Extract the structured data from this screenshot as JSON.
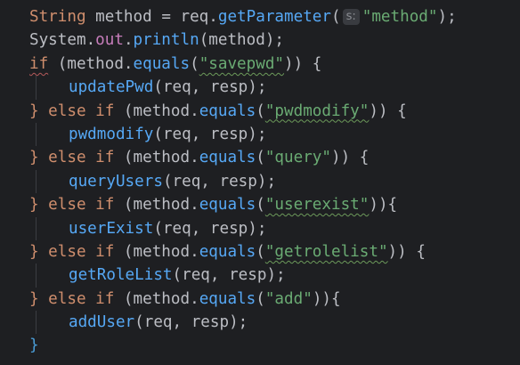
{
  "code": {
    "line1": {
      "type": "String",
      "var": "method",
      "eq": "=",
      "obj": "req",
      "call": "getParameter",
      "hint": "s:",
      "arg": "\"method\"",
      "tail": ");"
    },
    "line2": {
      "obj": "System",
      "field": "out",
      "call": "println",
      "args": "(method);"
    },
    "branches": [
      {
        "prefix": "if",
        "cond_open": " (method.",
        "equals": "equals",
        "arg": "\"savepwd\"",
        "cond_close": ")) {",
        "handler": "updatePwd",
        "handler_args": "(req, resp);"
      },
      {
        "prefix": "} else if",
        "cond_open": " (method.",
        "equals": "equals",
        "arg": "\"pwdmodify\"",
        "cond_close": ")) {",
        "handler": "pwdmodify",
        "handler_args": "(req, resp);"
      },
      {
        "prefix": "} else if",
        "cond_open": " (method.",
        "equals": "equals",
        "arg": "\"query\"",
        "cond_close": ")) {",
        "handler": "queryUsers",
        "handler_args": "(req, resp);"
      },
      {
        "prefix": "} else if",
        "cond_open": " (method.",
        "equals": "equals",
        "arg": "\"userexist\"",
        "cond_close": ")){",
        "handler": "userExist",
        "handler_args": "(req, resp);"
      },
      {
        "prefix": "} else if",
        "cond_open": " (method.",
        "equals": "equals",
        "arg": "\"getrolelist\"",
        "cond_close": ")) {",
        "handler": "getRoleList",
        "handler_args": "(req, resp);"
      },
      {
        "prefix": "} else if",
        "cond_open": " (method.",
        "equals": "equals",
        "arg": "\"add\"",
        "cond_close": ")){",
        "handler": "addUser",
        "handler_args": "(req, resp);"
      }
    ],
    "closing": "}"
  },
  "colors": {
    "background": "#1e1f22",
    "keyword": "#cf8e6d",
    "string": "#6aab73",
    "method": "#56a8f5",
    "field": "#c77dbb",
    "text": "#bcbec4"
  }
}
